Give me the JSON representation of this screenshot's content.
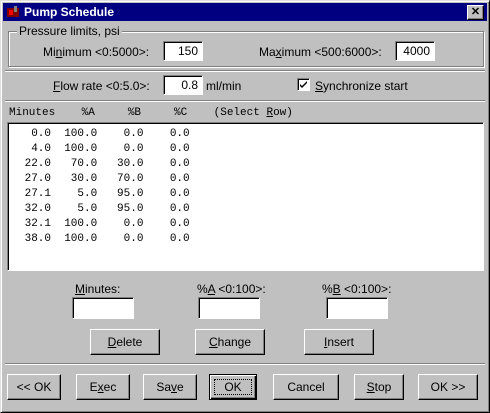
{
  "window": {
    "title": "Pump Schedule",
    "close_glyph": "✕"
  },
  "pressure": {
    "group_label": "Pressure limits, psi",
    "minimum": {
      "label_prefix": "Mi",
      "label_mnemonic": "n",
      "label_suffix": "imum <0:5000>:",
      "value": "150"
    },
    "maximum": {
      "label_prefix": "Ma",
      "label_mnemonic": "x",
      "label_suffix": "imum <500:6000>:",
      "value": "4000"
    }
  },
  "flow": {
    "label_mnemonic": "F",
    "label_suffix": "low rate  <0:5.0>:",
    "value": "0.8",
    "unit": "ml/min",
    "sync_label_mnemonic": "S",
    "sync_label_suffix": "ynchronize start",
    "sync_checked": true
  },
  "table": {
    "header_prefix": "Minutes    %A     %B     %C    (Select ",
    "header_mnemonic": "R",
    "header_suffix": "ow)",
    "rows": [
      "  0.0  100.0    0.0    0.0",
      "  4.0  100.0    0.0    0.0",
      " 22.0   70.0   30.0    0.0",
      " 27.0   30.0   70.0    0.0",
      " 27.1    5.0   95.0    0.0",
      " 32.0    5.0   95.0    0.0",
      " 32.1  100.0    0.0    0.0",
      " 38.0  100.0    0.0    0.0"
    ]
  },
  "edit": {
    "minutes_label_mnemonic": "M",
    "minutes_label_suffix": "inutes:",
    "minutes_value": "",
    "a_label_prefix": "%",
    "a_label_mnemonic": "A",
    "a_label_suffix": " <0:100>:",
    "a_value": "",
    "b_label_prefix": "%",
    "b_label_mnemonic": "B",
    "b_label_suffix": " <0:100>:",
    "b_value": ""
  },
  "row_buttons": {
    "delete": {
      "mnemonic": "D",
      "suffix": "elete"
    },
    "change": {
      "mnemonic": "C",
      "suffix": "hange"
    },
    "insert": {
      "mnemonic": "I",
      "suffix": "nsert"
    }
  },
  "footer_buttons": {
    "prev": "<< OK",
    "exec": {
      "prefix": "E",
      "mnemonic": "x",
      "suffix": "ec"
    },
    "save": {
      "prefix": "Sa",
      "mnemonic": "v",
      "suffix": "e"
    },
    "ok": "OK",
    "cancel": "Cancel",
    "stop": {
      "mnemonic": "S",
      "suffix": "top"
    },
    "next": "OK >>"
  },
  "colors": {
    "title_bar": "#000080",
    "face": "#c0c0c0",
    "field": "#ffffff"
  }
}
